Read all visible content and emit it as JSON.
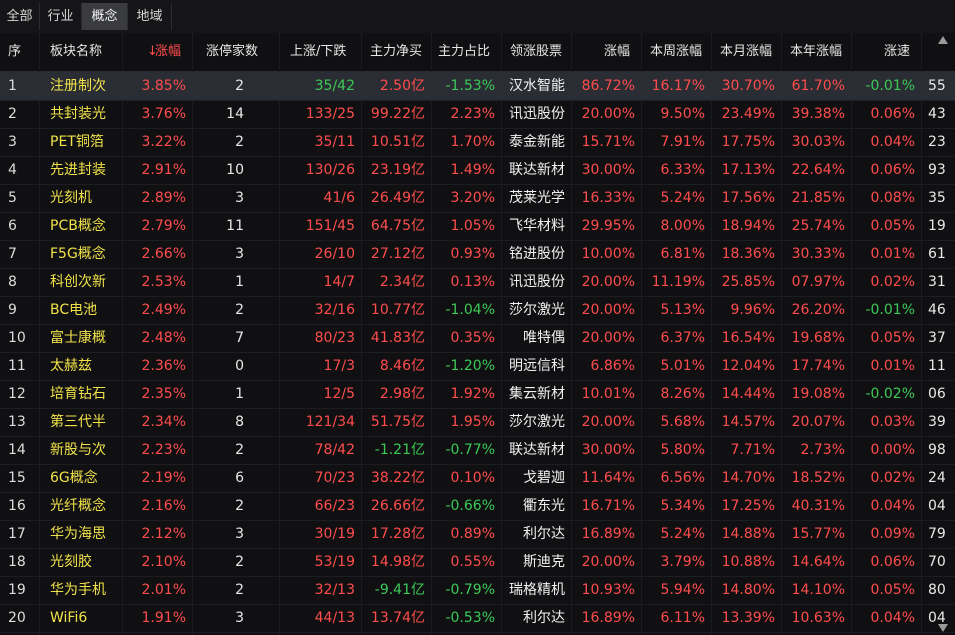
{
  "tabs": [
    "全部",
    "行业",
    "概念",
    "地域"
  ],
  "active_tab": 2,
  "headers": [
    "序",
    "板块名称",
    "涨幅",
    "涨停家数",
    "上涨/下跌",
    "主力净买",
    "主力占比",
    "领涨股票",
    "涨幅",
    "本周涨幅",
    "本月涨幅",
    "本年涨幅",
    "涨速"
  ],
  "sort_marker": "↓",
  "rows": [
    {
      "idx": "1",
      "name": "注册制次",
      "chg": "3.85%",
      "limit": "2",
      "updown": "35/42",
      "net": "2.50亿",
      "ratio": "-1.53%",
      "stock": "汉水智能",
      "schg": "86.72%",
      "week": "16.17%",
      "month": "30.70%",
      "year": "61.70%",
      "speed": "-0.01%",
      "extra": "55"
    },
    {
      "idx": "2",
      "name": "共封装光",
      "chg": "3.76%",
      "limit": "14",
      "updown": "133/25",
      "net": "99.22亿",
      "ratio": "2.23%",
      "stock": "讯迅股份",
      "schg": "20.00%",
      "week": "9.50%",
      "month": "23.49%",
      "year": "39.38%",
      "speed": "0.06%",
      "extra": "43"
    },
    {
      "idx": "3",
      "name": "PET铜箔",
      "chg": "3.22%",
      "limit": "2",
      "updown": "35/11",
      "net": "10.51亿",
      "ratio": "1.70%",
      "stock": "泰金新能",
      "schg": "15.71%",
      "week": "7.91%",
      "month": "17.75%",
      "year": "30.03%",
      "speed": "0.04%",
      "extra": "23"
    },
    {
      "idx": "4",
      "name": "先进封装",
      "chg": "2.91%",
      "limit": "10",
      "updown": "130/26",
      "net": "23.19亿",
      "ratio": "1.49%",
      "stock": "联达新材",
      "schg": "30.00%",
      "week": "6.33%",
      "month": "17.13%",
      "year": "22.64%",
      "speed": "0.06%",
      "extra": "93"
    },
    {
      "idx": "5",
      "name": "光刻机",
      "chg": "2.89%",
      "limit": "3",
      "updown": "41/6",
      "net": "26.49亿",
      "ratio": "3.20%",
      "stock": "茂莱光学",
      "schg": "16.33%",
      "week": "5.24%",
      "month": "17.56%",
      "year": "21.85%",
      "speed": "0.08%",
      "extra": "35"
    },
    {
      "idx": "6",
      "name": "PCB概念",
      "chg": "2.79%",
      "limit": "11",
      "updown": "151/45",
      "net": "64.75亿",
      "ratio": "1.05%",
      "stock": "飞华材料",
      "schg": "29.95%",
      "week": "8.00%",
      "month": "18.94%",
      "year": "25.74%",
      "speed": "0.05%",
      "extra": "19"
    },
    {
      "idx": "7",
      "name": "F5G概念",
      "chg": "2.66%",
      "limit": "3",
      "updown": "26/10",
      "net": "27.12亿",
      "ratio": "0.93%",
      "stock": "铭进股份",
      "schg": "10.00%",
      "week": "6.81%",
      "month": "18.36%",
      "year": "30.33%",
      "speed": "0.01%",
      "extra": "61"
    },
    {
      "idx": "8",
      "name": "科创次新",
      "chg": "2.53%",
      "limit": "1",
      "updown": "14/7",
      "net": "2.34亿",
      "ratio": "0.13%",
      "stock": "讯迅股份",
      "schg": "20.00%",
      "week": "11.19%",
      "month": "25.85%",
      "year": "07.97%",
      "speed": "0.02%",
      "extra": "31"
    },
    {
      "idx": "9",
      "name": "BC电池",
      "chg": "2.49%",
      "limit": "2",
      "updown": "32/16",
      "net": "10.77亿",
      "ratio": "-1.04%",
      "stock": "莎尔激光",
      "schg": "20.00%",
      "week": "5.13%",
      "month": "9.96%",
      "year": "26.20%",
      "speed": "-0.01%",
      "extra": "46"
    },
    {
      "idx": "10",
      "name": "富士康概",
      "chg": "2.48%",
      "limit": "7",
      "updown": "80/23",
      "net": "41.83亿",
      "ratio": "0.35%",
      "stock": "唯特偶",
      "schg": "20.00%",
      "week": "6.37%",
      "month": "16.54%",
      "year": "19.68%",
      "speed": "0.05%",
      "extra": "37"
    },
    {
      "idx": "11",
      "name": "太赫兹",
      "chg": "2.36%",
      "limit": "0",
      "updown": "17/3",
      "net": "8.46亿",
      "ratio": "-1.20%",
      "stock": "明远信科",
      "schg": "6.86%",
      "week": "5.01%",
      "month": "12.04%",
      "year": "17.74%",
      "speed": "0.01%",
      "extra": "11"
    },
    {
      "idx": "12",
      "name": "培育钻石",
      "chg": "2.35%",
      "limit": "1",
      "updown": "12/5",
      "net": "2.98亿",
      "ratio": "1.92%",
      "stock": "集云新材",
      "schg": "10.01%",
      "week": "8.26%",
      "month": "14.44%",
      "year": "19.08%",
      "speed": "-0.02%",
      "extra": "06"
    },
    {
      "idx": "13",
      "name": "第三代半",
      "chg": "2.34%",
      "limit": "8",
      "updown": "121/34",
      "net": "51.75亿",
      "ratio": "1.95%",
      "stock": "莎尔激光",
      "schg": "20.00%",
      "week": "5.68%",
      "month": "14.57%",
      "year": "20.07%",
      "speed": "0.03%",
      "extra": "39"
    },
    {
      "idx": "14",
      "name": "新股与次",
      "chg": "2.23%",
      "limit": "2",
      "updown": "78/42",
      "net": "-1.21亿",
      "ratio": "-0.77%",
      "stock": "联达新材",
      "schg": "30.00%",
      "week": "5.80%",
      "month": "7.71%",
      "year": "2.73%",
      "speed": "0.00%",
      "extra": "98"
    },
    {
      "idx": "15",
      "name": "6G概念",
      "chg": "2.19%",
      "limit": "6",
      "updown": "70/23",
      "net": "38.22亿",
      "ratio": "0.10%",
      "stock": "戈碧迦",
      "schg": "11.64%",
      "week": "6.56%",
      "month": "14.70%",
      "year": "18.52%",
      "speed": "0.02%",
      "extra": "24"
    },
    {
      "idx": "16",
      "name": "光纤概念",
      "chg": "2.16%",
      "limit": "2",
      "updown": "66/23",
      "net": "26.66亿",
      "ratio": "-0.66%",
      "stock": "衢东光",
      "schg": "16.71%",
      "week": "5.34%",
      "month": "17.25%",
      "year": "40.31%",
      "speed": "0.04%",
      "extra": "04"
    },
    {
      "idx": "17",
      "name": "华为海思",
      "chg": "2.12%",
      "limit": "3",
      "updown": "30/19",
      "net": "17.28亿",
      "ratio": "0.89%",
      "stock": "利尔达",
      "schg": "16.89%",
      "week": "5.24%",
      "month": "14.88%",
      "year": "15.77%",
      "speed": "0.09%",
      "extra": "79"
    },
    {
      "idx": "18",
      "name": "光刻胶",
      "chg": "2.10%",
      "limit": "2",
      "updown": "53/19",
      "net": "14.98亿",
      "ratio": "0.55%",
      "stock": "斯迪克",
      "schg": "20.00%",
      "week": "3.79%",
      "month": "10.88%",
      "year": "14.64%",
      "speed": "0.06%",
      "extra": "70"
    },
    {
      "idx": "19",
      "name": "华为手机",
      "chg": "2.01%",
      "limit": "2",
      "updown": "32/13",
      "net": "-9.41亿",
      "ratio": "-0.79%",
      "stock": "瑞格精机",
      "schg": "10.93%",
      "week": "5.94%",
      "month": "14.80%",
      "year": "14.10%",
      "speed": "0.05%",
      "extra": "80"
    },
    {
      "idx": "20",
      "name": "WiFi6",
      "chg": "1.91%",
      "limit": "3",
      "updown": "44/13",
      "net": "13.74亿",
      "ratio": "-0.53%",
      "stock": "利尔达",
      "schg": "16.89%",
      "week": "6.11%",
      "month": "13.39%",
      "year": "10.63%",
      "speed": "0.04%",
      "extra": "04"
    }
  ],
  "colors": {
    "up": "#ff4d4d",
    "down": "#3cc957",
    "name": "#f0e24a",
    "selected_row": "#2a2d33"
  }
}
